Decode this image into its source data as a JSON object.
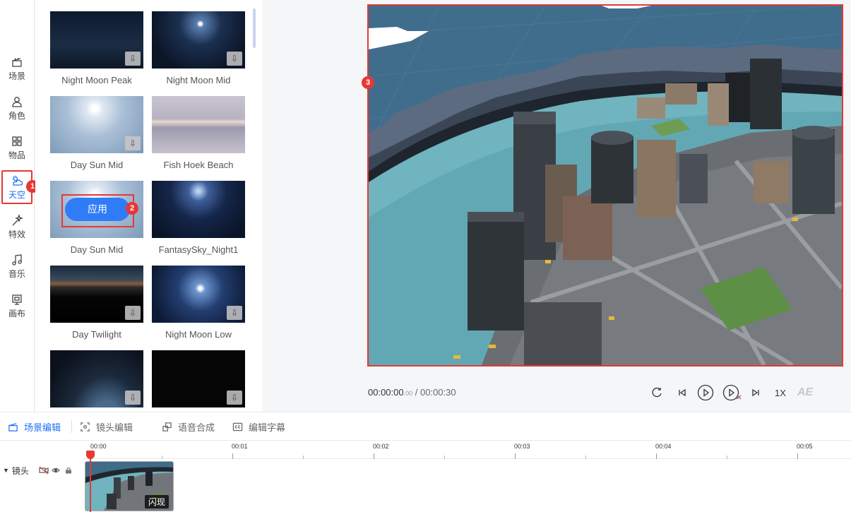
{
  "nav": {
    "items": [
      {
        "label": "场景",
        "icon": "clapperboard-icon"
      },
      {
        "label": "角色",
        "icon": "person-icon"
      },
      {
        "label": "物品",
        "icon": "grid-icon"
      },
      {
        "label": "天空",
        "icon": "cloud-sun-icon",
        "active": true
      },
      {
        "label": "特效",
        "icon": "magic-wand-icon"
      },
      {
        "label": "音乐",
        "icon": "music-note-icon"
      },
      {
        "label": "画布",
        "icon": "canvas-icon"
      }
    ]
  },
  "markers": [
    "1",
    "2",
    "3"
  ],
  "sky_panel": {
    "tiles": [
      {
        "label": "Night Moon Peak",
        "downloadable": true
      },
      {
        "label": "Night Moon Mid",
        "downloadable": true
      },
      {
        "label": "Day Sun Mid",
        "downloadable": true
      },
      {
        "label": "Fish Hoek Beach",
        "downloadable": false
      },
      {
        "label": "Day Sun Mid",
        "downloadable": false,
        "hovered": true
      },
      {
        "label": "FantasySky_Night1",
        "downloadable": false
      },
      {
        "label": "Day Twilight",
        "downloadable": true
      },
      {
        "label": "Night Moon Low",
        "downloadable": true
      },
      {
        "label": "",
        "downloadable": true
      },
      {
        "label": "",
        "downloadable": true
      }
    ],
    "apply_label": "应用",
    "download_glyph": "⇩"
  },
  "player": {
    "current_time": "00:00:00",
    "current_ms": ".00",
    "separator": " / ",
    "total_time": "00:00:30",
    "speed": "1X",
    "ae_label": "AE"
  },
  "editor_tabs": [
    {
      "label": "场景编辑",
      "active": true
    },
    {
      "label": "镜头编辑"
    },
    {
      "label": "语音合成"
    },
    {
      "label": "编辑字幕"
    }
  ],
  "timeline": {
    "ticks": [
      "00:00",
      "00:01",
      "00:02",
      "00:03",
      "00:04",
      "00:05"
    ],
    "track_label": "镜头",
    "clip_label": "闪现"
  },
  "colors": {
    "accent": "#1e6ff5",
    "marker": "#e53935",
    "apply_button": "#2f7cf6"
  }
}
